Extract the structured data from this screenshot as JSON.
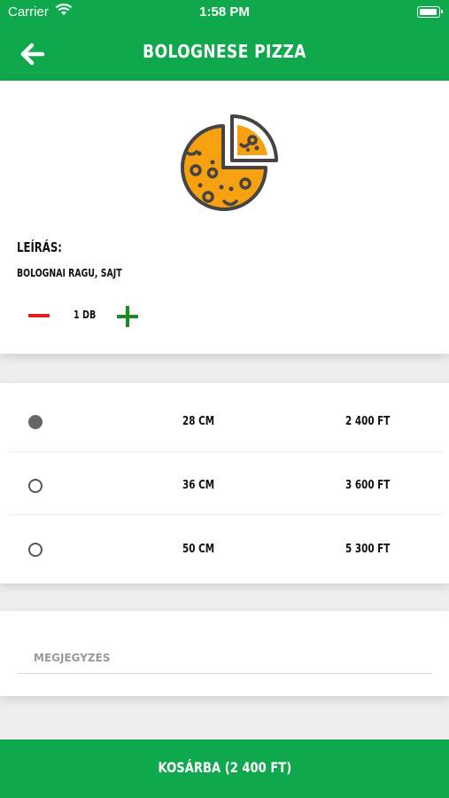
{
  "status_bar": {
    "carrier": "Carrier",
    "time": "1:58 PM"
  },
  "header": {
    "title": "BOLOGNESE PIZZA",
    "back_icon": "arrow-left-icon",
    "background_color": "#0fa84c"
  },
  "product": {
    "image_icon": "pizza-icon",
    "description_label": "LEÍRÁS:",
    "description": "BOLOGNAI RAGU, SAJT",
    "quantity": "1 DB",
    "minus_color": "#e02020",
    "plus_color": "#1e8b1e"
  },
  "sizes": [
    {
      "label": "28 CM",
      "price": "2 400 FT",
      "selected": true
    },
    {
      "label": "36 CM",
      "price": "3 600 FT",
      "selected": false
    },
    {
      "label": "50 CM",
      "price": "5 300 FT",
      "selected": false
    }
  ],
  "note": {
    "placeholder": "MEGJEGYZÉS",
    "value": ""
  },
  "cart_button": {
    "label": "KOSÁRBA (2 400 FT)"
  }
}
